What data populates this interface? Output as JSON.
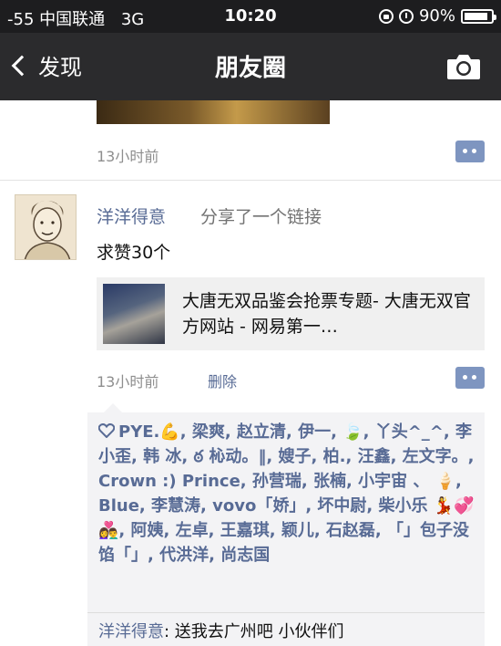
{
  "status_bar": {
    "carrier": "-55 中国联通",
    "network": "3G",
    "time": "10:20",
    "battery": "90%"
  },
  "nav": {
    "back_label": "发现",
    "title": "朋友圈"
  },
  "previous_post": {
    "time": "13小时前"
  },
  "post": {
    "author": "洋洋得意",
    "shared_label": "分享了一个链接",
    "text": "求赞30个",
    "link_title": "大唐无双品鉴会抢票专题- 大唐无双官方网站 - 网易第一…",
    "time": "13小时前",
    "delete_label": "删除"
  },
  "likes": {
    "names": "PYE.💪, 梁爽, 赵立清, 伊一, 🍃, 丫头^_^, 李小歪, 韩 冰, ఠ 杺动。‖, 嫂子, 柏., 汪鑫, 左文字。, Crown :) Prince, 孙营瑞, 张楠, 小宇宙 、 🍦, Blue, 李慧涛, vovo「娇」, 坏中尉, 柴小乐 💃💞👩‍❤️‍👨, 阿姨, 左卓, 王嘉琪, 颖儿, 石赵磊, 「」包子没馅「」, 代洪洋, 尚志国"
  },
  "comment": {
    "author": "洋洋得意",
    "separator": ": ",
    "text": "送我去广州吧 小伙伴们"
  },
  "colors": {
    "link_blue": "#586b95",
    "nav_bg": "#2b2b2d",
    "comment_button": "#7e95c0"
  }
}
